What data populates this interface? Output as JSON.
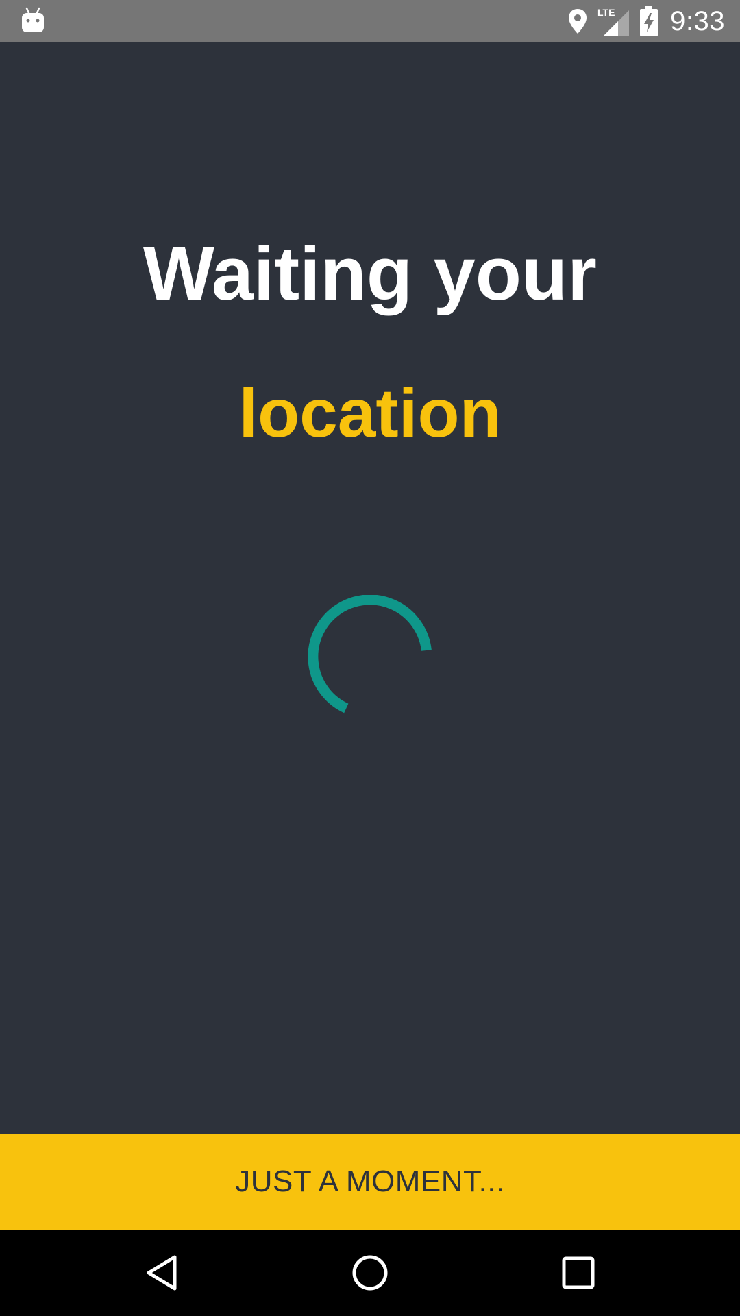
{
  "status_bar": {
    "time": "9:33",
    "icons": [
      "android-notification-icon",
      "location-icon",
      "lte-signal-icon",
      "battery-charging-icon"
    ],
    "network_label": "LTE",
    "background_color": "#767676"
  },
  "main": {
    "title_line1": "Waiting your",
    "title_line2": "location",
    "title_color": "#ffffff",
    "highlight_color": "#f8c20d",
    "background_color": "#2d323b",
    "spinner": {
      "icon": "loading-spinner",
      "color": "#0f978a"
    }
  },
  "footer": {
    "button_label": "JUST A MOMENT...",
    "button_color": "#f8c20d"
  },
  "nav_bar": {
    "items": [
      "back-icon",
      "home-icon",
      "recents-icon"
    ]
  }
}
